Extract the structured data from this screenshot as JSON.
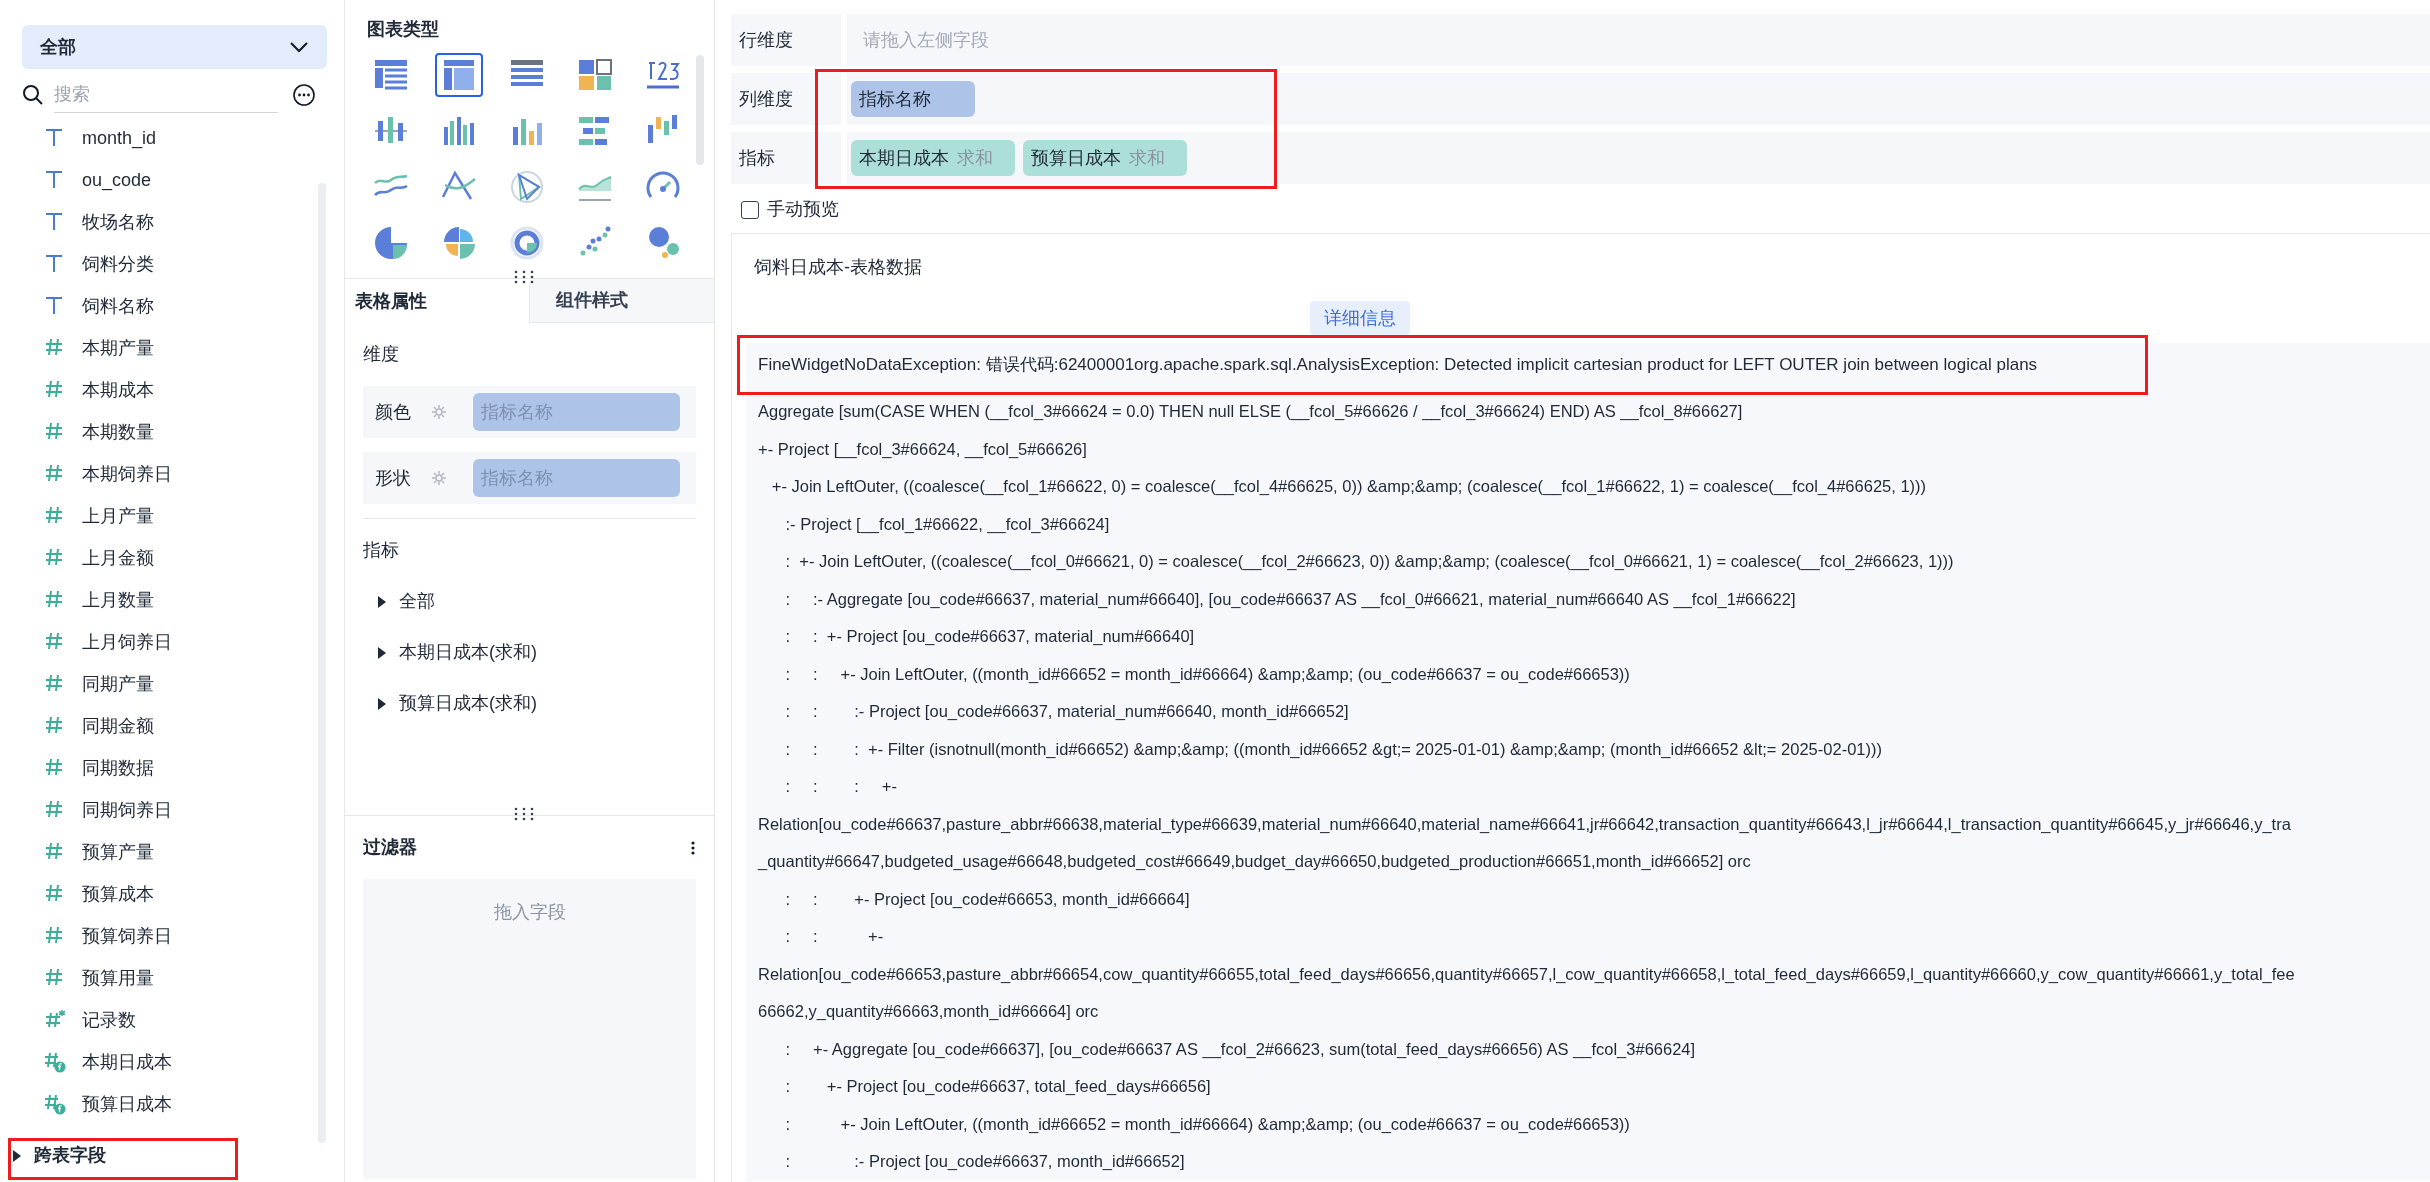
{
  "field_panel": {
    "dropdown": "全部",
    "search": {
      "placeholder": "搜索"
    },
    "fields": [
      {
        "kind": "text",
        "label": "month_id"
      },
      {
        "kind": "text",
        "label": "ou_code"
      },
      {
        "kind": "text",
        "label": "牧场名称"
      },
      {
        "kind": "text",
        "label": "饲料分类"
      },
      {
        "kind": "text",
        "label": "饲料名称"
      },
      {
        "kind": "number",
        "label": "本期产量"
      },
      {
        "kind": "number",
        "label": "本期成本"
      },
      {
        "kind": "number",
        "label": "本期数量"
      },
      {
        "kind": "number",
        "label": "本期饲养日"
      },
      {
        "kind": "number",
        "label": "上月产量"
      },
      {
        "kind": "number",
        "label": "上月金额"
      },
      {
        "kind": "number",
        "label": "上月数量"
      },
      {
        "kind": "number",
        "label": "上月饲养日"
      },
      {
        "kind": "number",
        "label": "同期产量"
      },
      {
        "kind": "number",
        "label": "同期金额"
      },
      {
        "kind": "number",
        "label": "同期数据"
      },
      {
        "kind": "number",
        "label": "同期饲养日"
      },
      {
        "kind": "number",
        "label": "预算产量"
      },
      {
        "kind": "number",
        "label": "预算成本"
      },
      {
        "kind": "number",
        "label": "预算饲养日"
      },
      {
        "kind": "number",
        "label": "预算用量"
      },
      {
        "kind": "count",
        "label": "记录数"
      },
      {
        "kind": "calculated",
        "label": "本期日成本"
      },
      {
        "kind": "calculated",
        "label": "预算日成本"
      }
    ],
    "cross_table": {
      "label": "跨表字段",
      "expanded": false
    }
  },
  "config_panel": {
    "chart_types_title": "图表类型",
    "chart_types": [
      {
        "selected": false
      },
      {
        "selected": true
      },
      {
        "selected": false
      },
      {
        "selected": false
      },
      {
        "selected": false
      },
      {
        "selected": false
      },
      {
        "selected": false
      },
      {
        "selected": false
      },
      {
        "selected": false
      },
      {
        "selected": false
      },
      {
        "selected": false
      },
      {
        "selected": false
      },
      {
        "selected": false
      },
      {
        "selected": false
      },
      {
        "selected": false
      },
      {
        "selected": false
      },
      {
        "selected": false
      },
      {
        "selected": false
      },
      {
        "selected": false
      },
      {
        "selected": false
      }
    ],
    "tabs": [
      {
        "label": "表格属性",
        "selected": true
      },
      {
        "label": "组件样式",
        "selected": false
      }
    ],
    "dimension_title": "维度",
    "dimension_rows": [
      {
        "label": "颜色",
        "value": "指标名称"
      },
      {
        "label": "形状",
        "value": "指标名称"
      }
    ],
    "measure_title": "指标",
    "measure_items": [
      {
        "label": "全部",
        "expanded": false
      },
      {
        "label": "本期日成本(求和)",
        "expanded": false
      },
      {
        "label": "预算日成本(求和)",
        "expanded": false
      }
    ],
    "filter_title": "过滤器",
    "filter_drop": "拖入字段"
  },
  "shelves": [
    {
      "label": "行维度",
      "placeholder": "请拖入左侧字段"
    },
    {
      "label": "列维度",
      "chips": [
        {
          "kind": "dimension",
          "name": "指标名称"
        }
      ]
    },
    {
      "label": "指标",
      "chips": [
        {
          "kind": "measure",
          "name": "本期日成本",
          "agg": "求和"
        },
        {
          "kind": "measure",
          "name": "预算日成本",
          "agg": "求和"
        }
      ]
    }
  ],
  "manual_preview": {
    "label": "手动预览",
    "checked": false
  },
  "result": {
    "title": "饲料日成本-表格数据",
    "detail_button": "详细信息",
    "error_headline": "FineWidgetNoDataException: 错误代码:62400001org.apache.spark.sql.AnalysisException: Detected implicit cartesian product for LEFT OUTER join between logical plans",
    "log_lines": [
      "Aggregate [sum(CASE WHEN (__fcol_3#66624 = 0.0) THEN null ELSE (__fcol_5#66626 / __fcol_3#66624) END) AS __fcol_8#66627]",
      "+- Project [__fcol_3#66624, __fcol_5#66626]",
      "   +- Join LeftOuter, ((coalesce(__fcol_1#66622, 0) = coalesce(__fcol_4#66625, 0)) &amp;&amp; (coalesce(__fcol_1#66622, 1) = coalesce(__fcol_4#66625, 1)))",
      "      :- Project [__fcol_1#66622, __fcol_3#66624]",
      "      :  +- Join LeftOuter, ((coalesce(__fcol_0#66621, 0) = coalesce(__fcol_2#66623, 0)) &amp;&amp; (coalesce(__fcol_0#66621, 1) = coalesce(__fcol_2#66623, 1)))",
      "      :     :- Aggregate [ou_code#66637, material_num#66640], [ou_code#66637 AS __fcol_0#66621, material_num#66640 AS __fcol_1#66622]",
      "      :     :  +- Project [ou_code#66637, material_num#66640]",
      "      :     :     +- Join LeftOuter, ((month_id#66652 = month_id#66664) &amp;&amp; (ou_code#66637 = ou_code#66653))",
      "      :     :        :- Project [ou_code#66637, material_num#66640, month_id#66652]",
      "      :     :        :  +- Filter (isnotnull(month_id#66652) &amp;&amp; ((month_id#66652 &gt;= 2025-01-01) &amp;&amp; (month_id#66652 &lt;= 2025-02-01)))",
      "      :     :        :     +-",
      "Relation[ou_code#66637,pasture_abbr#66638,material_type#66639,material_num#66640,material_name#66641,jr#66642,transaction_quantity#66643,l_jr#66644,l_transaction_quantity#66645,y_jr#66646,y_tra",
      "_quantity#66647,budgeted_usage#66648,budgeted_cost#66649,budget_day#66650,budgeted_production#66651,month_id#66652] orc",
      "      :     :        +- Project [ou_code#66653, month_id#66664]",
      "      :     :           +-",
      "Relation[ou_code#66653,pasture_abbr#66654,cow_quantity#66655,total_feed_days#66656,quantity#66657,l_cow_quantity#66658,l_total_feed_days#66659,l_quantity#66660,y_cow_quantity#66661,y_total_fee",
      "66662,y_quantity#66663,month_id#66664] orc",
      "      :     +- Aggregate [ou_code#66637], [ou_code#66637 AS __fcol_2#66623, sum(total_feed_days#66656) AS __fcol_3#66624]",
      "      :        +- Project [ou_code#66637, total_feed_days#66656]",
      "      :           +- Join LeftOuter, ((month_id#66652 = month_id#66664) &amp;&amp; (ou_code#66637 = ou_code#66653))",
      "      :              :- Project [ou_code#66637, month_id#66652]"
    ]
  }
}
